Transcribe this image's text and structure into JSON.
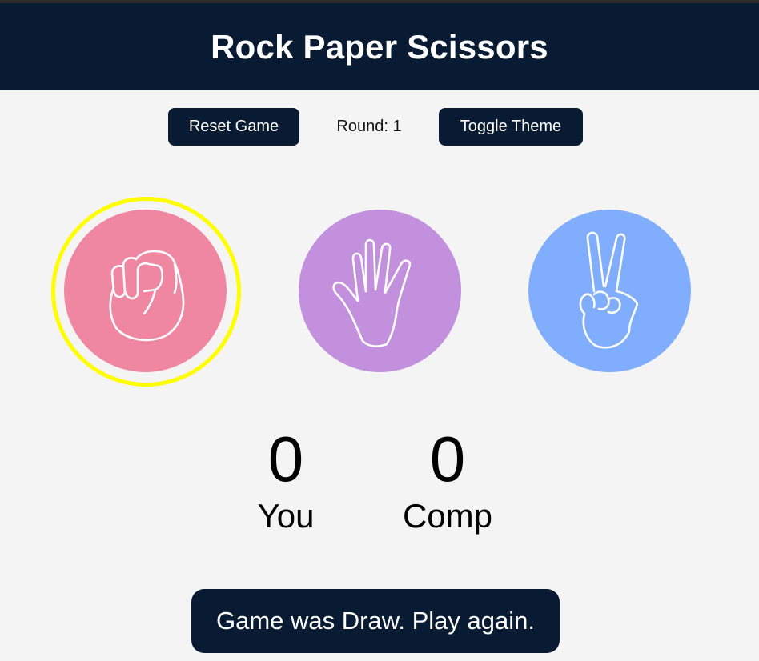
{
  "header": {
    "title": "Rock Paper Scissors"
  },
  "controls": {
    "reset_label": "Reset Game",
    "round_label": "Round:",
    "round_value": "1",
    "theme_label": "Toggle Theme"
  },
  "choices": [
    {
      "name": "rock",
      "icon": "fist-icon",
      "color": "#f087a2",
      "selected": true
    },
    {
      "name": "paper",
      "icon": "open-hand-icon",
      "color": "#c390de",
      "selected": false
    },
    {
      "name": "scissors",
      "icon": "peace-hand-icon",
      "color": "#80adfd",
      "selected": false
    }
  ],
  "selection_ring_color": "#ffff00",
  "scores": {
    "you": {
      "value": "0",
      "label": "You"
    },
    "comp": {
      "value": "0",
      "label": "Comp"
    }
  },
  "result_message": "Game was Draw. Play again.",
  "colors": {
    "primary_dark": "#081b33",
    "background": "#f4f4f4"
  }
}
